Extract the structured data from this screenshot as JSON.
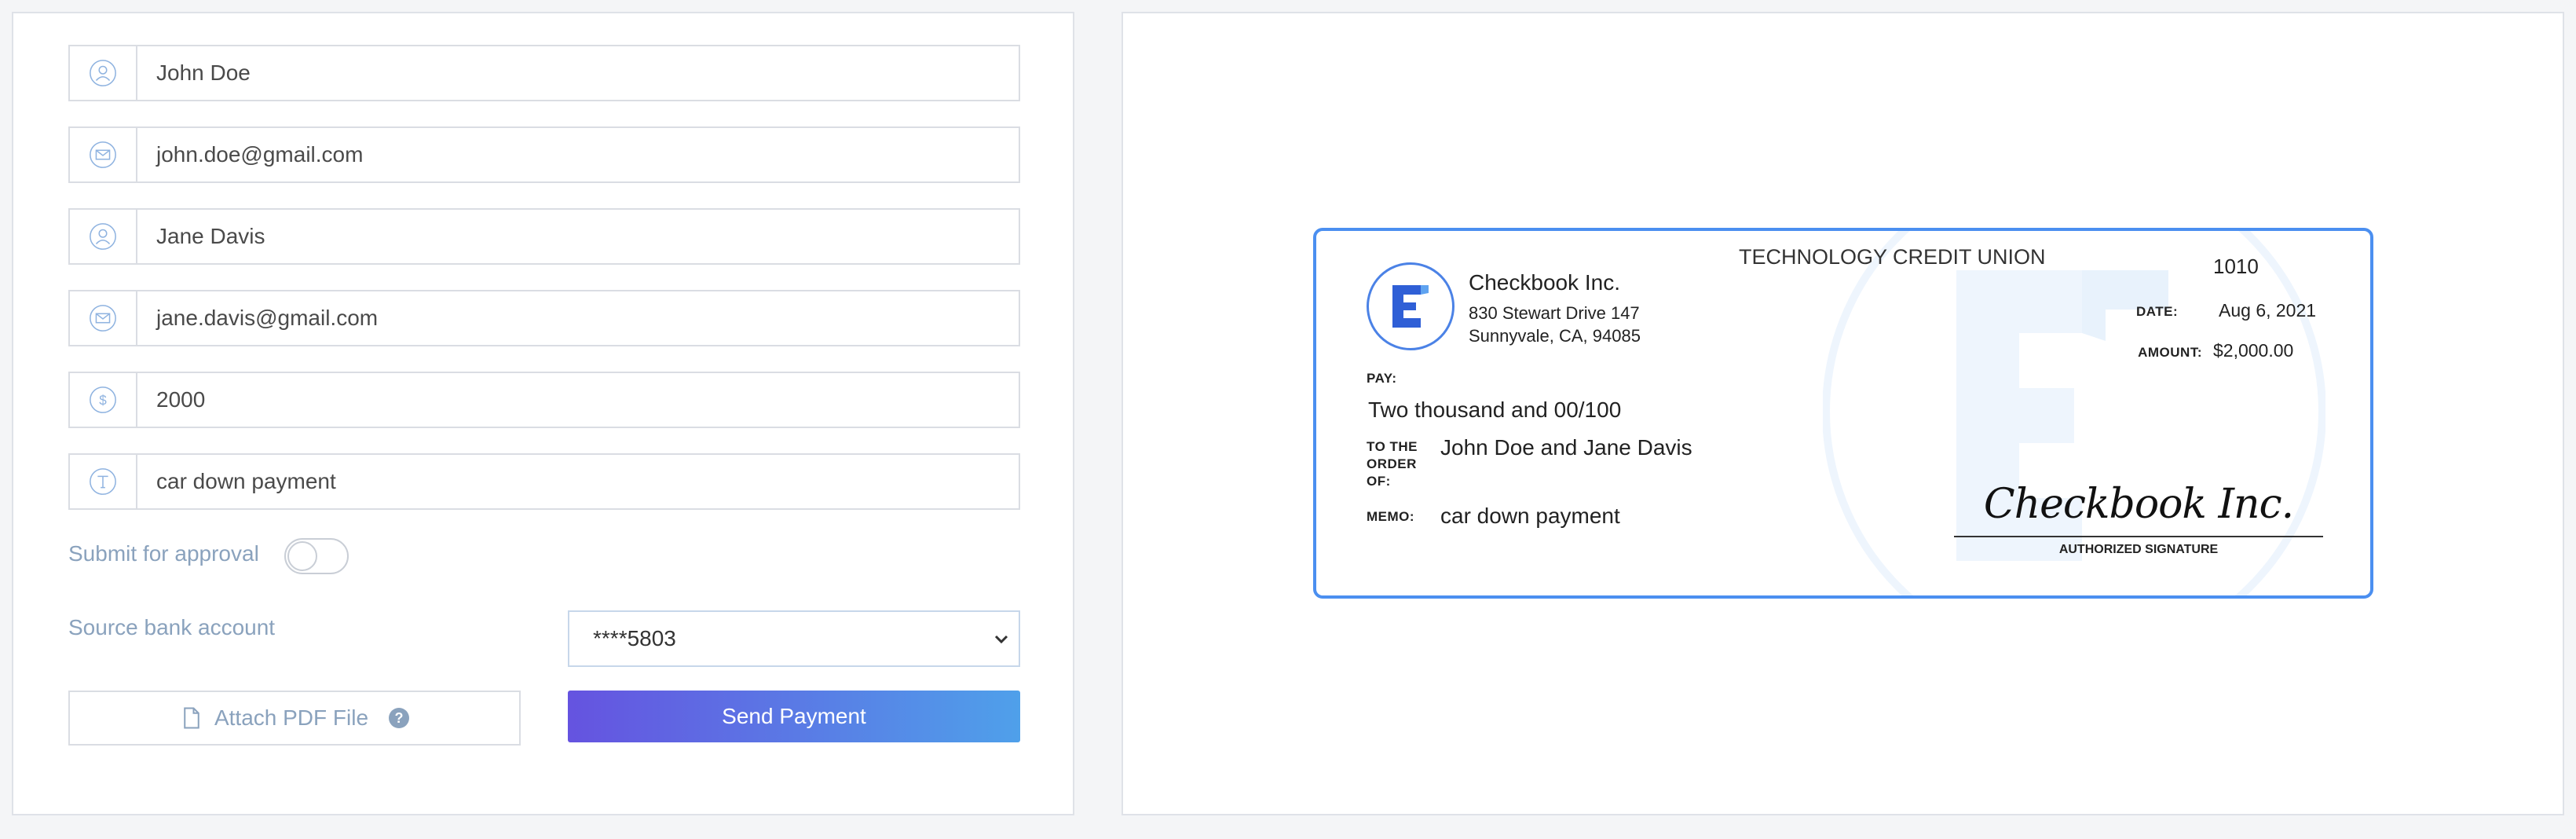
{
  "form": {
    "sender_name": "John Doe",
    "sender_email": "john.doe@gmail.com",
    "recipient_name": "Jane Davis",
    "recipient_email": "jane.davis@gmail.com",
    "amount": "2000",
    "memo": "car down payment",
    "approval_label": "Submit for approval",
    "approval_enabled": false,
    "source_label": "Source bank account",
    "source_value": "****5803",
    "attach_label": "Attach PDF File",
    "send_label": "Send Payment"
  },
  "check": {
    "bank_name": "TECHNOLOGY CREDIT UNION",
    "check_number": "1010",
    "company_name": "Checkbook Inc.",
    "address_line1": "830 Stewart Drive 147",
    "address_line2": "Sunnyvale, CA, 94085",
    "date_label": "DATE:",
    "date_value": "Aug 6, 2021",
    "amount_label": "AMOUNT:",
    "amount_value": "$2,000.00",
    "pay_label": "PAY:",
    "pay_words": "Two thousand and 00/100",
    "order_label_1": "TO THE",
    "order_label_2": "ORDER",
    "order_label_3": "OF:",
    "payees": "John Doe and Jane Davis",
    "memo_label": "MEMO:",
    "memo_value": "car down payment",
    "signature": "Checkbook Inc.",
    "signature_label": "AUTHORIZED SIGNATURE"
  },
  "colors": {
    "accent_start": "#6553e0",
    "accent_end": "#4fa0ea",
    "label": "#8aa2bd",
    "check_border": "#4b8ff0"
  },
  "icons": [
    "user-icon",
    "envelope-icon",
    "user-icon",
    "envelope-icon",
    "dollar-icon",
    "text-icon",
    "file-icon",
    "help-icon",
    "chevron-down-icon",
    "checkbook-logo-icon"
  ]
}
